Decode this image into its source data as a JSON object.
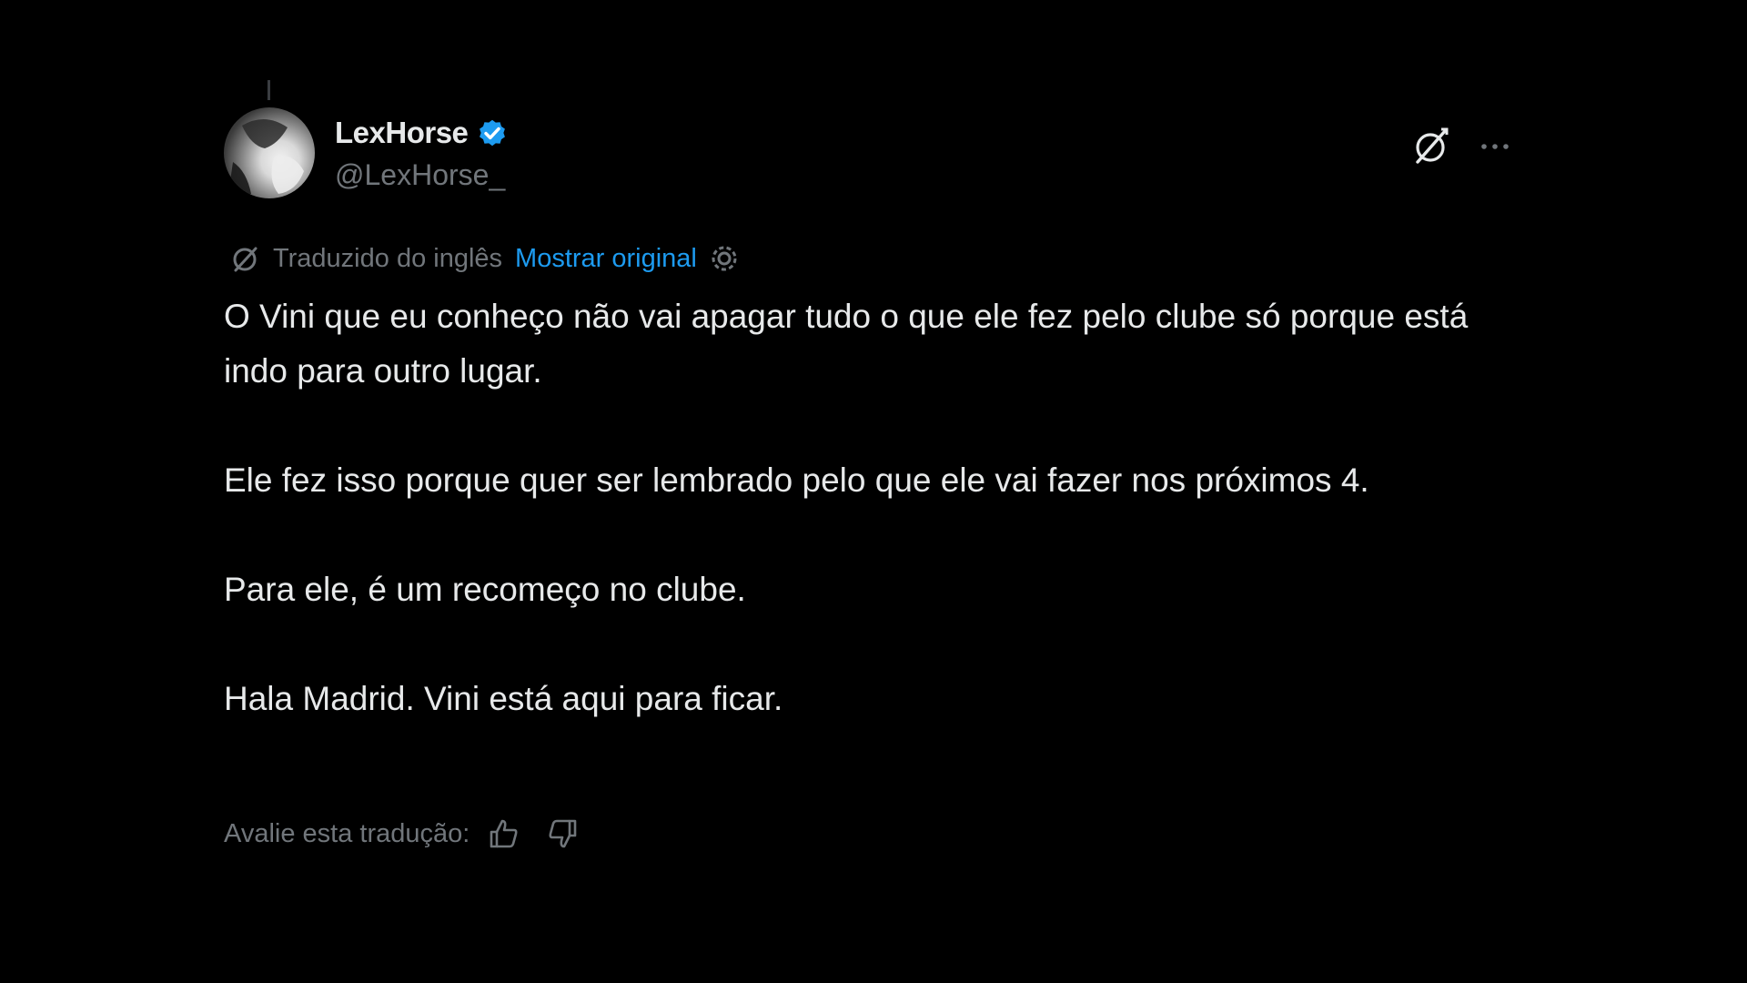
{
  "tweet": {
    "author": {
      "display_name": "LexHorse",
      "handle": "@LexHorse_",
      "verified": true,
      "verified_color": "#1d9bf0"
    },
    "actions": {
      "grok_icon": "grok-icon",
      "more_icon": "more-icon"
    },
    "translation": {
      "label": "Traduzido do inglês",
      "show_original": "Mostrar original",
      "link_color": "#1d9bf0"
    },
    "paragraphs": [
      "O Vini que eu conheço não vai apagar tudo o que ele fez pelo clube só porque está indo para outro lugar.",
      "Ele fez isso porque quer ser lembrado pelo que ele vai fazer nos próximos 4.",
      "Para ele, é um recomeço no clube.",
      "Hala Madrid. Vini está aqui para ficar."
    ],
    "rate": {
      "label": "Avalie esta tradução:"
    }
  }
}
